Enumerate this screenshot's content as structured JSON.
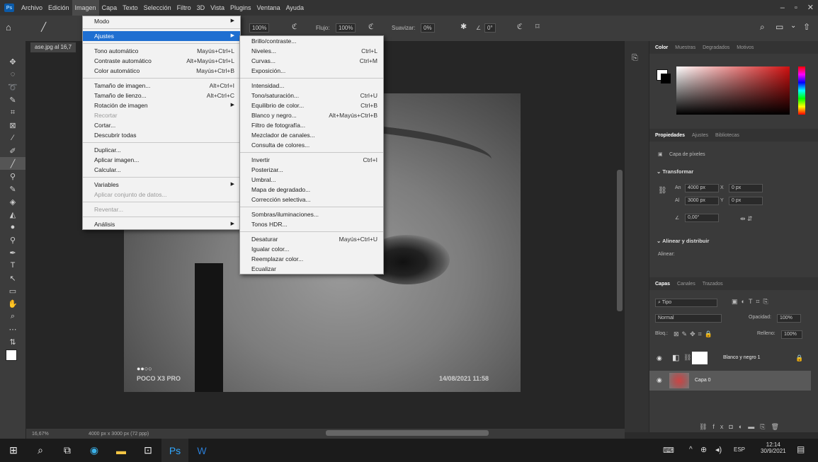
{
  "menubar": {
    "logo": "Ps",
    "items": [
      "Archivo",
      "Edición",
      "Imagen",
      "Capa",
      "Texto",
      "Selección",
      "Filtro",
      "3D",
      "Vista",
      "Plugins",
      "Ventana",
      "Ayuda"
    ],
    "window_controls": [
      "–",
      "▫",
      "✕"
    ]
  },
  "options": {
    "flujo_label": "Flujo:",
    "flujo_value": "100%",
    "suavizar_label": "Suavizar:",
    "suavizar_value": "0%",
    "angle_value": "0°",
    "opacity_value": "100%"
  },
  "document": {
    "tab_title": "ase.jpg al 16,7",
    "zoom": "16,67%",
    "size": "4000 px x 3000 px (72 ppp)",
    "watermark_left": "POCO X3 PRO",
    "watermark_right": "14/08/2021 11:58"
  },
  "imagen_menu": {
    "items": [
      {
        "label": "Modo",
        "sc": "",
        "sub": true
      },
      {
        "sep": true
      },
      {
        "label": "Ajustes",
        "sc": "",
        "sub": true,
        "hl": true
      },
      {
        "sep": true
      },
      {
        "label": "Tono automático",
        "sc": "Mayús+Ctrl+L"
      },
      {
        "label": "Contraste automático",
        "sc": "Alt+Mayús+Ctrl+L"
      },
      {
        "label": "Color automático",
        "sc": "Mayús+Ctrl+B"
      },
      {
        "sep": true
      },
      {
        "label": "Tamaño de imagen...",
        "sc": "Alt+Ctrl+I"
      },
      {
        "label": "Tamaño de lienzo...",
        "sc": "Alt+Ctrl+C"
      },
      {
        "label": "Rotación de imagen",
        "sc": "",
        "sub": true
      },
      {
        "label": "Recortar",
        "sc": "",
        "dis": true
      },
      {
        "label": "Cortar...",
        "sc": ""
      },
      {
        "label": "Descubrir todas",
        "sc": ""
      },
      {
        "sep": true
      },
      {
        "label": "Duplicar...",
        "sc": ""
      },
      {
        "label": "Aplicar imagen...",
        "sc": ""
      },
      {
        "label": "Calcular...",
        "sc": ""
      },
      {
        "sep": true
      },
      {
        "label": "Variables",
        "sc": "",
        "sub": true
      },
      {
        "label": "Aplicar conjunto de datos...",
        "sc": "",
        "dis": true
      },
      {
        "sep": true
      },
      {
        "label": "Reventar...",
        "sc": "",
        "dis": true
      },
      {
        "sep": true
      },
      {
        "label": "Análisis",
        "sc": "",
        "sub": true
      }
    ]
  },
  "ajustes_menu": {
    "items": [
      {
        "label": "Brillo/contraste...",
        "sc": ""
      },
      {
        "label": "Niveles...",
        "sc": "Ctrl+L"
      },
      {
        "label": "Curvas...",
        "sc": "Ctrl+M"
      },
      {
        "label": "Exposición...",
        "sc": ""
      },
      {
        "sep": true
      },
      {
        "label": "Intensidad...",
        "sc": ""
      },
      {
        "label": "Tono/saturación...",
        "sc": "Ctrl+U"
      },
      {
        "label": "Equilibrio de color...",
        "sc": "Ctrl+B"
      },
      {
        "label": "Blanco y negro...",
        "sc": "Alt+Mayús+Ctrl+B"
      },
      {
        "label": "Filtro de fotografía...",
        "sc": ""
      },
      {
        "label": "Mezclador de canales...",
        "sc": ""
      },
      {
        "label": "Consulta de colores...",
        "sc": ""
      },
      {
        "sep": true
      },
      {
        "label": "Invertir",
        "sc": "Ctrl+I"
      },
      {
        "label": "Posterizar...",
        "sc": ""
      },
      {
        "label": "Umbral...",
        "sc": ""
      },
      {
        "label": "Mapa de degradado...",
        "sc": ""
      },
      {
        "label": "Corrección selectiva...",
        "sc": ""
      },
      {
        "sep": true
      },
      {
        "label": "Sombras/iluminaciones...",
        "sc": ""
      },
      {
        "label": "Tonos HDR...",
        "sc": ""
      },
      {
        "sep": true
      },
      {
        "label": "Desaturar",
        "sc": "Mayús+Ctrl+U"
      },
      {
        "label": "Igualar color...",
        "sc": ""
      },
      {
        "label": "Reemplazar color...",
        "sc": ""
      },
      {
        "label": "Ecualizar",
        "sc": ""
      }
    ]
  },
  "color_panel": {
    "tabs": [
      "Color",
      "Muestras",
      "Degradados",
      "Motivos"
    ],
    "accent": "#d01010"
  },
  "properties_panel": {
    "tabs": [
      "Propiedades",
      "Ajustes",
      "Bibliotecas"
    ],
    "layer_type": "Capa de píxeles",
    "transform_header": "Transformar",
    "w_label": "An",
    "w_value": "4000 px",
    "h_label": "Al",
    "h_value": "3000 px",
    "x_label": "X",
    "x_value": "0 px",
    "y_label": "Y",
    "y_value": "0 px",
    "angle_value": "0,00°",
    "align_header": "Alinear y distribuir",
    "align_label": "Alinear:"
  },
  "layers_panel": {
    "tabs": [
      "Capas",
      "Canales",
      "Trazados"
    ],
    "filter": "Tipo",
    "blend_mode": "Normal",
    "opacity_label": "Opacidad:",
    "opacity_value": "100%",
    "lock_label": "Bloq.:",
    "fill_label": "Relleno:",
    "fill_value": "100%",
    "layers": [
      {
        "name": "Blanco y negro 1",
        "type": "adjustment"
      },
      {
        "name": "Capa 0",
        "type": "pixel"
      }
    ]
  },
  "taskbar": {
    "lang": "ESP",
    "time": "12:14",
    "date": "30/9/2021"
  }
}
